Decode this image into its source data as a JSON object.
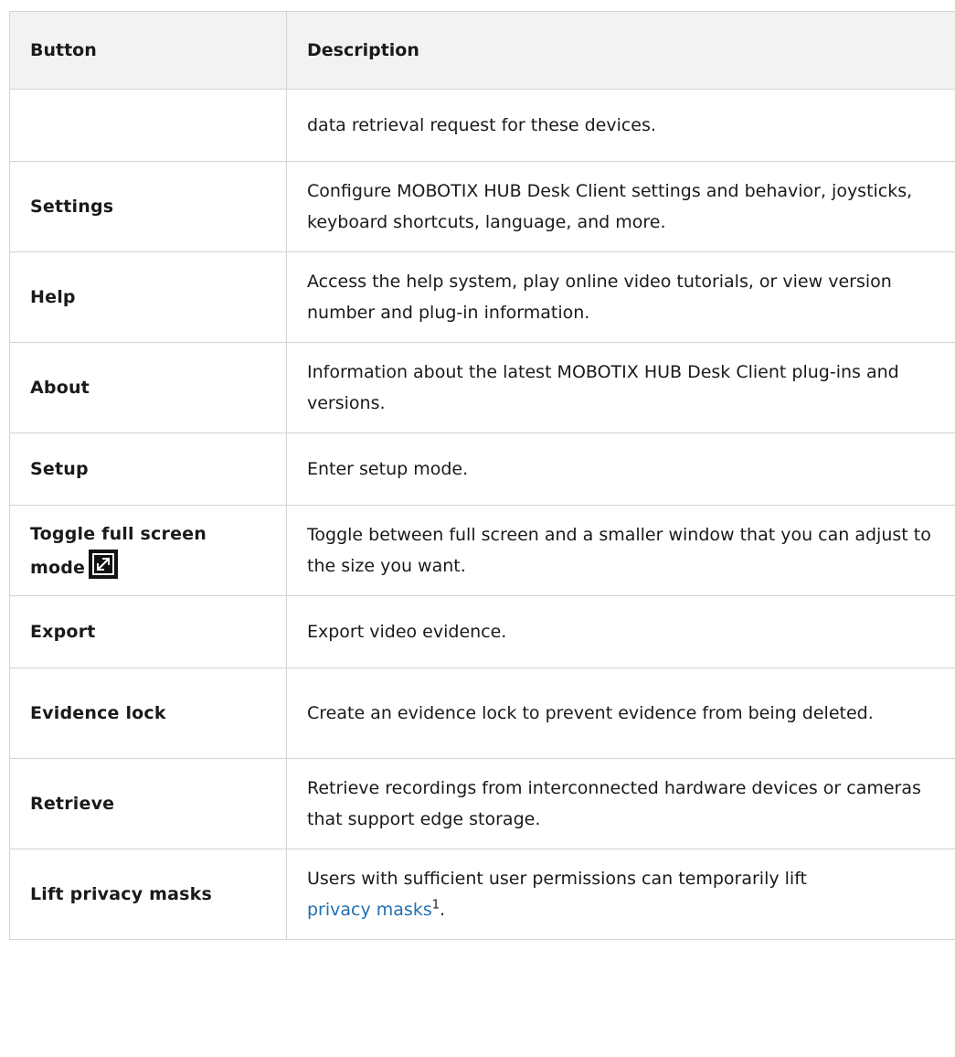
{
  "table": {
    "headers": [
      "Button",
      "Description"
    ],
    "rows": [
      {
        "button": "",
        "description": "data retrieval request for these devices."
      },
      {
        "button": "Settings",
        "description": "Configure MOBOTIX HUB Desk Client settings and behavior, joysticks, keyboard shortcuts, language, and more."
      },
      {
        "button": "Help",
        "description": "Access the help system, play online video tutorials, or view version number and plug-in information."
      },
      {
        "button": "About",
        "description": "Information about the latest MOBOTIX HUB Desk Client plug-ins and versions."
      },
      {
        "button": "Setup",
        "description": "Enter setup mode."
      },
      {
        "button": "Toggle full screen mode",
        "description": "Toggle between full screen and a smaller window that you can adjust to the size you want."
      },
      {
        "button": "Export",
        "description": "Export video evidence."
      },
      {
        "button": "Evidence lock",
        "description": "Create an evidence lock to prevent evidence from being deleted."
      },
      {
        "button": "Retrieve",
        "description": "Retrieve recordings from interconnected hardware devices or cameras that support edge storage."
      },
      {
        "button": "Lift privacy masks",
        "description_prefix": "Users with sufficient user permissions can temporarily lift",
        "link_text": "privacy masks",
        "footnote": "1",
        "description_suffix": "."
      }
    ]
  },
  "icons": {
    "fullscreen": "fullscreen-toggle-icon"
  },
  "colors": {
    "link": "#1f6fb5",
    "header_bg": "#f2f2f2",
    "border": "#d4d4d4",
    "icon_bg": "#111111"
  }
}
